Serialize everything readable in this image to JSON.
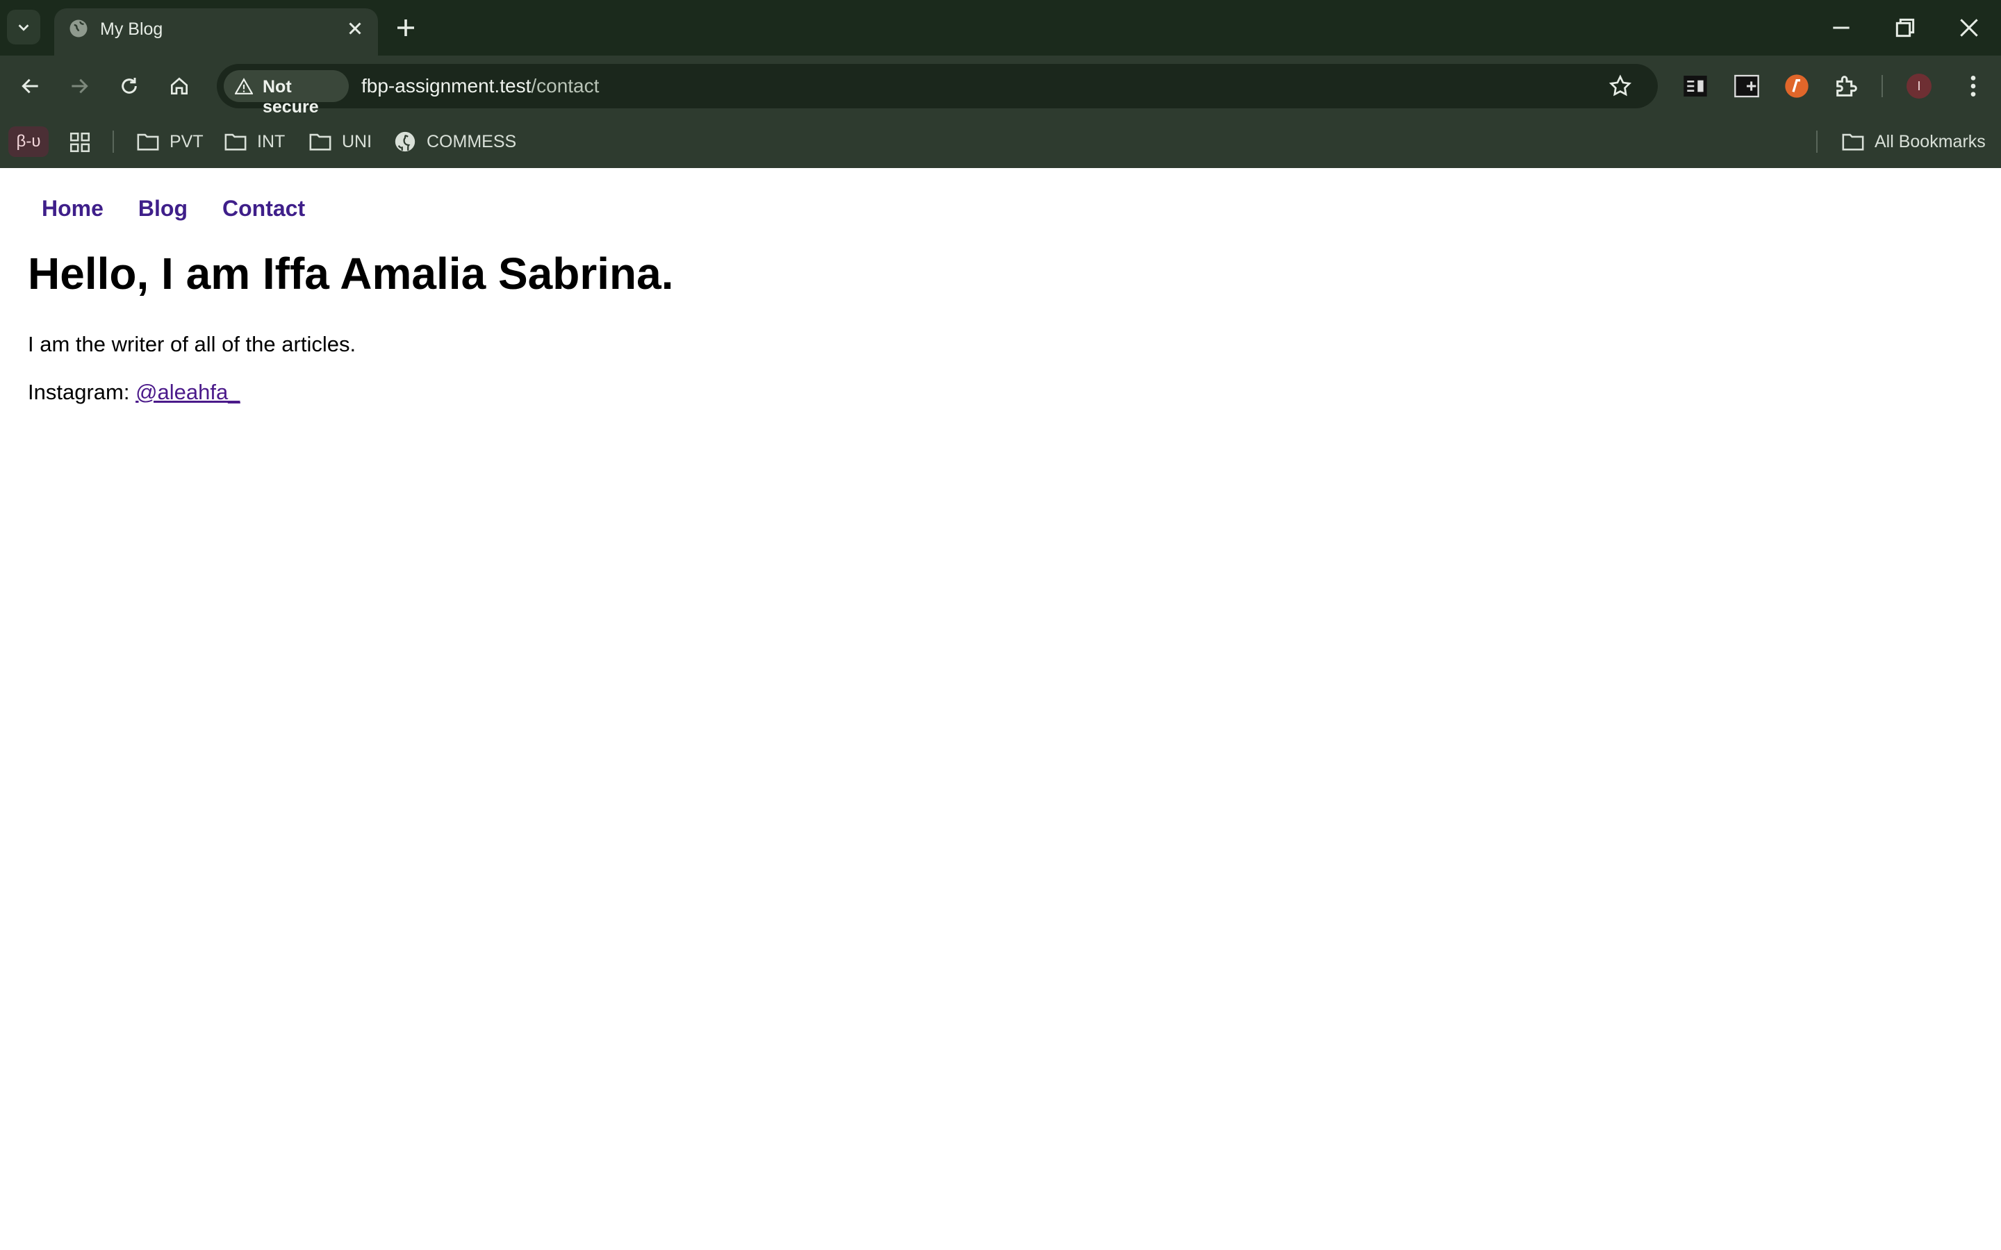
{
  "browser": {
    "tab": {
      "title": "My Blog"
    },
    "address_bar": {
      "security_label": "Not secure",
      "url_host": "fbp-assignment.test",
      "url_path": "/contact"
    },
    "bookmarks": {
      "beta_label": "β-υ",
      "items": [
        {
          "label": "PVT",
          "icon": "folder-icon"
        },
        {
          "label": "INT",
          "icon": "folder-icon"
        },
        {
          "label": "UNI",
          "icon": "folder-icon"
        },
        {
          "label": "COMMESS",
          "icon": "github-icon"
        }
      ],
      "all_bookmarks": "All Bookmarks"
    },
    "profile_initial": "I",
    "colors": {
      "frame": "#1b2a1c",
      "toolbar": "#2e3b2f",
      "omnibox": "#1b271c"
    }
  },
  "page": {
    "nav": [
      "Home",
      "Blog",
      "Contact"
    ],
    "heading": "Hello, I am Iffa Amalia Sabrina.",
    "intro": "I am the writer of all of the articles.",
    "instagram_label": "Instagram:",
    "instagram_handle": "@aleahfa_",
    "colors": {
      "link": "#3f1f8a"
    }
  }
}
